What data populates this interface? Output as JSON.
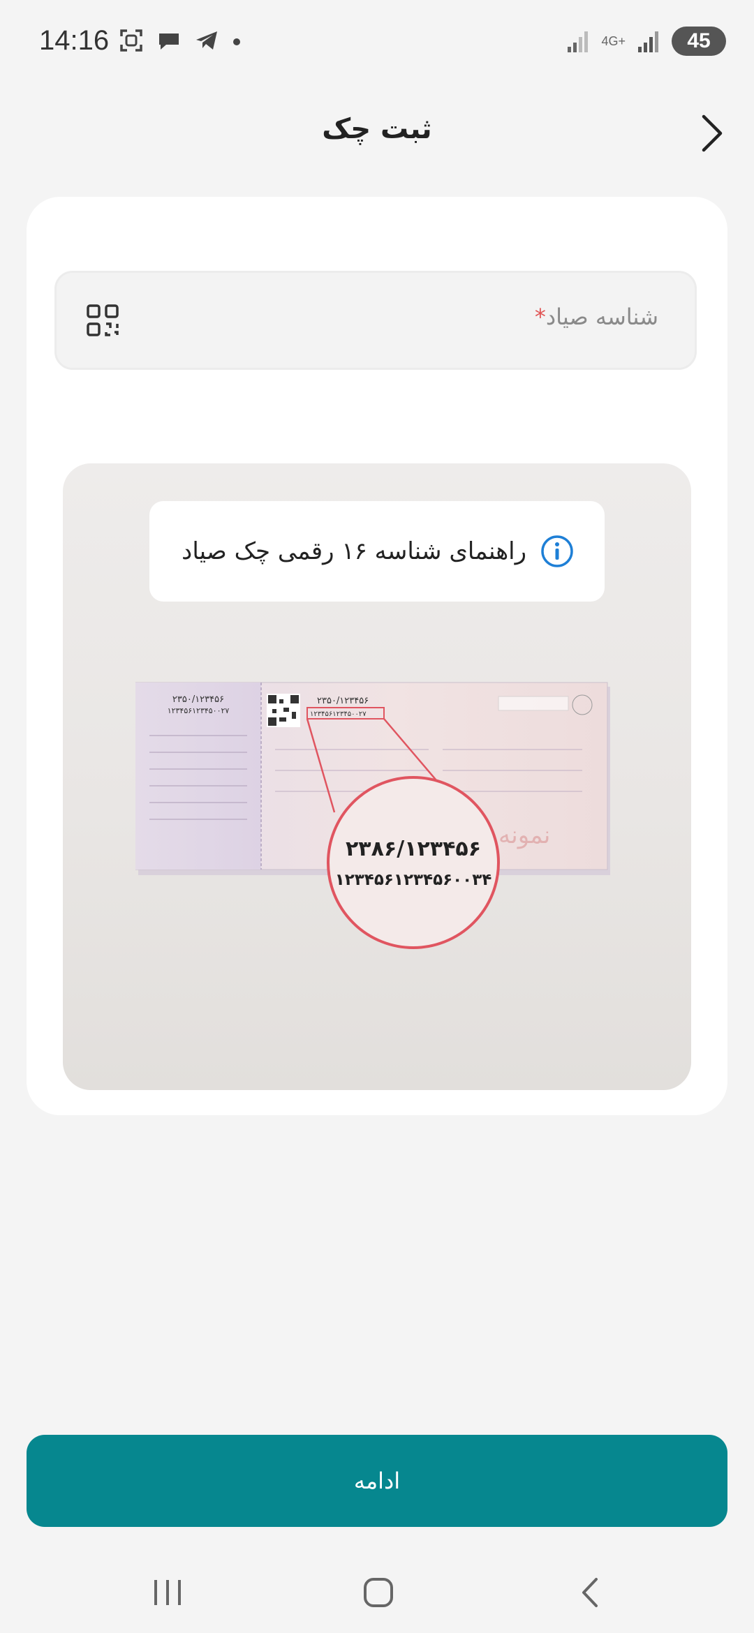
{
  "status_bar": {
    "time": "14:16",
    "network": "4G+",
    "battery": "45"
  },
  "header": {
    "title": "ثبت چک"
  },
  "form": {
    "field_label": "شناسه صیاد",
    "required_mark": "*"
  },
  "guide": {
    "title": "راهنمای شناسه ۱۶ رقمی چک صیاد",
    "cheque_series": "۲۳۸۶/۱۲۳۴۵۶",
    "cheque_id": "۱۲۳۴۵۶۱۲۳۴۵۶۰۰۳۴",
    "small_series": "۲۳۵۰/۱۲۳۴۵۶",
    "small_id": "۱۲۳۴۵۶۱۲۳۴۵۰۰۲۷",
    "watermark": "نمونه"
  },
  "actions": {
    "continue_label": "ادامه"
  },
  "colors": {
    "primary": "#06878f",
    "required": "#e05555",
    "info": "#1e7fd6"
  }
}
